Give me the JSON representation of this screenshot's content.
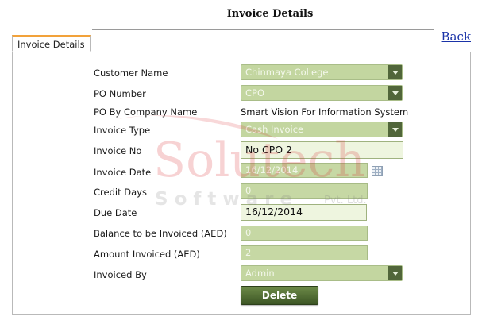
{
  "page": {
    "title": "Invoice Details",
    "back_label": "Back",
    "tab_label": "Invoice Details"
  },
  "form": {
    "customer_name": {
      "label": "Customer Name",
      "value": "Chinmaya College"
    },
    "po_number": {
      "label": "PO Number",
      "value": "CPO"
    },
    "po_by_company": {
      "label": "PO By Company Name",
      "value": "Smart Vision For Information System"
    },
    "invoice_type": {
      "label": "Invoice Type",
      "value": "Cash Invoice"
    },
    "invoice_no": {
      "label": "Invoice No",
      "value": "No CPO  2"
    },
    "invoice_date": {
      "label": "Invoice Date",
      "value": "16/12/2014"
    },
    "credit_days": {
      "label": "Credit Days",
      "value": "0"
    },
    "due_date": {
      "label": "Due Date",
      "value": "16/12/2014"
    },
    "balance_to_invoice": {
      "label": "Balance to be Invoiced (AED)",
      "value": "0"
    },
    "amount_invoiced": {
      "label": "Amount Invoiced (AED)",
      "value": "2"
    },
    "invoiced_by": {
      "label": "Invoiced By",
      "value": "Admin"
    },
    "delete_label": "Delete"
  },
  "watermark": {
    "brand_line1": "Solutech",
    "brand_line2": "S o f t w a r e",
    "suffix": "Pvt. Ltd."
  },
  "colors": {
    "accent_tab": "#f2a23a",
    "field_green": "#c3d6a0",
    "button_green": "#4a6530",
    "link_blue": "#1a33a8",
    "watermark_red": "#d8262b"
  }
}
